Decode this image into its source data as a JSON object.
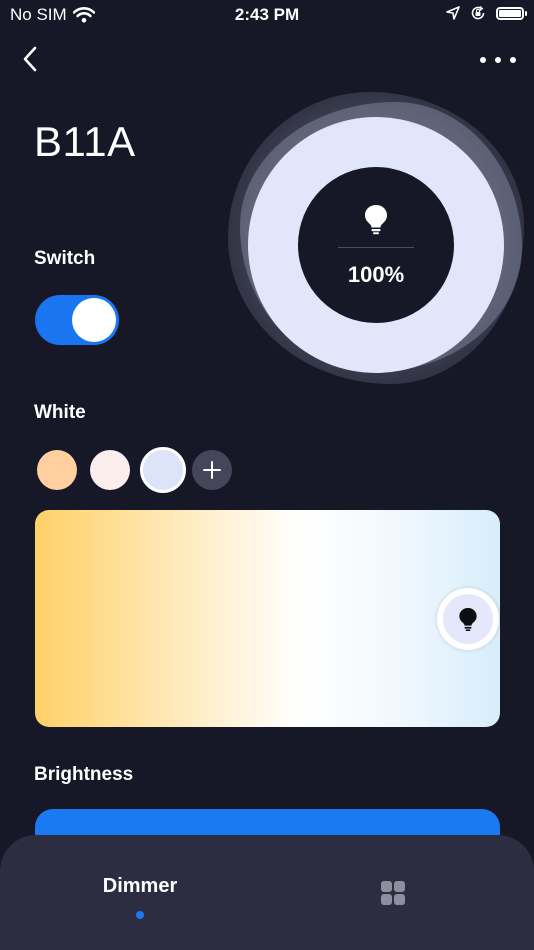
{
  "status_bar": {
    "carrier": "No SIM",
    "time": "2:43 PM",
    "icons": [
      "wifi-icon",
      "location-icon",
      "orientation-lock-icon",
      "battery-icon"
    ]
  },
  "header": {
    "back_icon": "chevron-left-icon",
    "more_icon": "more-horizontal-icon"
  },
  "device": {
    "title": "B11A",
    "brightness_display": "100%",
    "brightness_level": 100,
    "bulb_icon": "lightbulb-icon"
  },
  "switch": {
    "label": "Switch",
    "on": true
  },
  "white": {
    "label": "White",
    "presets": [
      {
        "color": "#ffcf9f",
        "selected": false
      },
      {
        "color": "#fdeeee",
        "selected": false
      },
      {
        "color": "#dde4fa",
        "selected": true
      }
    ],
    "add_icon": "plus-icon",
    "temperature_position": 1.0
  },
  "brightness": {
    "label": "Brightness",
    "value": 100
  },
  "bottom_nav": {
    "tabs": [
      {
        "label": "Dimmer",
        "active": true
      },
      {
        "label": "",
        "icon": "grid-icon",
        "active": false
      }
    ]
  },
  "colors": {
    "background": "#161727",
    "accent": "#1976f0",
    "nav_background": "#2c2d40"
  }
}
